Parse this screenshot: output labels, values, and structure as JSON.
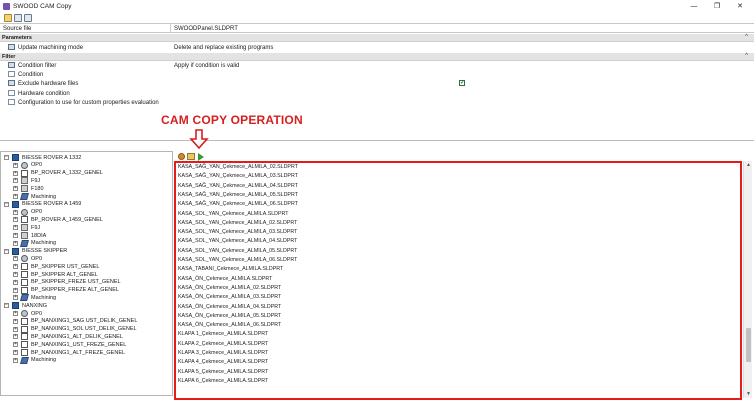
{
  "window": {
    "title": "SWOOD CAM Copy",
    "minimize": "—",
    "maximize": "❐",
    "close": "✕"
  },
  "source": {
    "label": "Source file",
    "value": "SWOODPanel.SLDPRT"
  },
  "parameters": {
    "header": "Parameters",
    "update_label": "Update machining mode",
    "update_value": "Delete and replace existing programs"
  },
  "filter": {
    "header": "Filter",
    "condition_filter_label": "Condition filter",
    "condition_filter_value": "Apply if condition is valid",
    "condition_label": "Condition",
    "exclude_label": "Exclude hardware files",
    "exclude_checked": "✓",
    "hardware_label": "Hardware condition",
    "config_label": "Configuration to use for custom properties evaluation"
  },
  "annotation": {
    "text": "CAM COPY OPERATION",
    "color": "#d61f1f"
  },
  "tree": [
    {
      "level": 0,
      "type": "machine",
      "label": "BIESSE ROVER A 1332",
      "expander": "−"
    },
    {
      "level": 1,
      "type": "op",
      "label": "OP0",
      "expander": "+"
    },
    {
      "level": 1,
      "type": "program",
      "label": "BP_ROVER A_1332_GENEL",
      "expander": "+"
    },
    {
      "level": 1,
      "type": "tool",
      "label": "F9J",
      "expander": "+"
    },
    {
      "level": 1,
      "type": "tool",
      "label": "F180",
      "expander": "+"
    },
    {
      "level": 1,
      "type": "machining",
      "label": "Machining",
      "expander": "+"
    },
    {
      "level": 0,
      "type": "machine",
      "label": "BIESSE ROVER A 1459",
      "expander": "−"
    },
    {
      "level": 1,
      "type": "op",
      "label": "OP0",
      "expander": "+"
    },
    {
      "level": 1,
      "type": "program",
      "label": "BP_ROVER A_1459_GENEL",
      "expander": "+"
    },
    {
      "level": 1,
      "type": "tool",
      "label": "F9J",
      "expander": "+"
    },
    {
      "level": 1,
      "type": "tool",
      "label": "18DIA",
      "expander": "+"
    },
    {
      "level": 1,
      "type": "machining",
      "label": "Machining",
      "expander": "+"
    },
    {
      "level": 0,
      "type": "machine",
      "label": "BIESSE SKIPPER",
      "expander": "−"
    },
    {
      "level": 1,
      "type": "op",
      "label": "OP0",
      "expander": "+"
    },
    {
      "level": 1,
      "type": "program",
      "label": "BP_SKIPPER UST_GENEL",
      "expander": "+"
    },
    {
      "level": 1,
      "type": "program",
      "label": "BP_SKIPPER ALT_GENEL",
      "expander": "+"
    },
    {
      "level": 1,
      "type": "program",
      "label": "BP_SKIPPER_FREZE UST_GENEL",
      "expander": "+"
    },
    {
      "level": 1,
      "type": "program",
      "label": "BP_SKIPPER_FREZE ALT_GENEL",
      "expander": "+"
    },
    {
      "level": 1,
      "type": "machining",
      "label": "Machining",
      "expander": "+"
    },
    {
      "level": 0,
      "type": "machine",
      "label": "NANXING",
      "expander": "−"
    },
    {
      "level": 1,
      "type": "op",
      "label": "OP0",
      "expander": "+"
    },
    {
      "level": 1,
      "type": "program",
      "label": "BP_NANXING1_SAG UST_DELIK_GENEL",
      "expander": "+"
    },
    {
      "level": 1,
      "type": "program",
      "label": "BP_NANXING1_SOL UST_DELIK_GENEL",
      "expander": "+"
    },
    {
      "level": 1,
      "type": "program",
      "label": "BP_NANXING1_ALT_DELIK_GENEL",
      "expander": "+"
    },
    {
      "level": 1,
      "type": "program",
      "label": "BP_NANXING1_UST_FREZE_GENEL",
      "expander": "+"
    },
    {
      "level": 1,
      "type": "program",
      "label": "BP_NANXING1_ALT_FREZE_GENEL",
      "expander": "+"
    },
    {
      "level": 1,
      "type": "machining",
      "label": "Machining",
      "expander": "+"
    }
  ],
  "files": [
    "KASA_SAĞ_YAN_Çekmece_ALMILA_02.SLDPRT",
    "KASA_SAĞ_YAN_Çekmece_ALMILA_03.SLDPRT",
    "KASA_SAĞ_YAN_Çekmece_ALMILA_04.SLDPRT",
    "KASA_SAĞ_YAN_Çekmece_ALMILA_05.SLDPRT",
    "KASA_SAĞ_YAN_Çekmece_ALMILA_06.SLDPRT",
    "KASA_SOL_YAN_Çekmece_ALMILA.SLDPRT",
    "KASA_SOL_YAN_Çekmece_ALMILA_02.SLDPRT",
    "KASA_SOL_YAN_Çekmece_ALMILA_03.SLDPRT",
    "KASA_SOL_YAN_Çekmece_ALMILA_04.SLDPRT",
    "KASA_SOL_YAN_Çekmece_ALMILA_05.SLDPRT",
    "KASA_SOL_YAN_Çekmece_ALMILA_06.SLDPRT",
    "KASA_TABANI_Çekmece_ALMILA.SLDPRT",
    "KASA_ÖN_Çekmece_ALMILA.SLDPRT",
    "KASA_ÖN_Çekmece_ALMILA_02.SLDPRT",
    "KASA_ÖN_Çekmece_ALMILA_03.SLDPRT",
    "KASA_ÖN_Çekmece_ALMILA_04.SLDPRT",
    "KASA_ÖN_Çekmece_ALMILA_05.SLDPRT",
    "KASA_ÖN_Çekmece_ALMILA_06.SLDPRT",
    "KLAPA 1_Çekmece_ALMILA.SLDPRT",
    "KLAPA 2_Çekmece_ALMILA.SLDPRT",
    "KLAPA 3_Çekmece_ALMILA.SLDPRT",
    "KLAPA 4_Çekmece_ALMILA.SLDPRT",
    "KLAPA 5_Çekmece_ALMILA.SLDPRT",
    "KLAPA 6_Çekmece_ALMILA.SLDPRT"
  ],
  "scrollbar": {
    "up": "▲",
    "down": "▼",
    "position": 0.85
  },
  "icons": {
    "window": "swood-app-icon",
    "open": "folder-open-icon",
    "save": "save-icon",
    "saveas": "save-all-icon",
    "refresh": "refresh-icon",
    "load": "folder-load-icon",
    "run": "play-icon"
  }
}
